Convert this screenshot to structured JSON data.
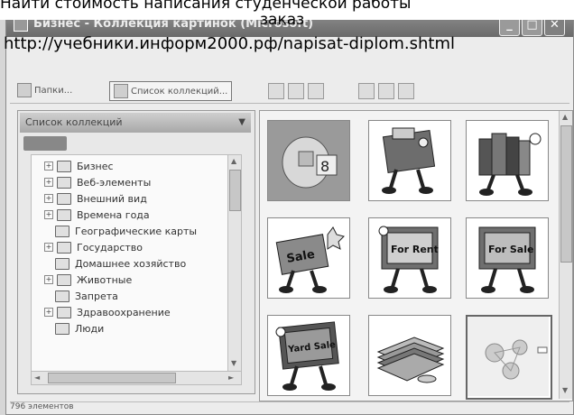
{
  "overlay": {
    "line1": "Найти стоимость написания студенческой работы",
    "line2": "заказ",
    "url": "http://учебники.информ2000.рф/napisat-diplom.shtml"
  },
  "window": {
    "title": "Бизнес - Коллекция картинок (Microsoft)",
    "min_label": "_",
    "max_label": "□",
    "close_label": "✕"
  },
  "toolbar": {
    "items": [
      {
        "label": "Папки..."
      },
      {
        "label": "Список коллекций..."
      }
    ]
  },
  "left_pane": {
    "header": "Список коллекций",
    "tree": [
      {
        "label": "Бизнес",
        "expandable": true
      },
      {
        "label": "Веб-элементы",
        "expandable": true
      },
      {
        "label": "Внешний вид",
        "expandable": true
      },
      {
        "label": "Времена года",
        "expandable": true
      },
      {
        "label": "Географические карты",
        "expandable": false
      },
      {
        "label": "Государство",
        "expandable": true
      },
      {
        "label": "Домашнее хозяйство",
        "expandable": false
      },
      {
        "label": "Животные",
        "expandable": true
      },
      {
        "label": "Запрета",
        "expandable": false
      },
      {
        "label": "Здравоохранение",
        "expandable": true
      },
      {
        "label": "Люди",
        "expandable": false
      }
    ]
  },
  "clips": [
    {
      "name": "clip-robot",
      "text": "8"
    },
    {
      "name": "clip-wallet-walker",
      "text": ""
    },
    {
      "name": "clip-books-walker",
      "text": ""
    },
    {
      "name": "clip-sale-sign",
      "text": "Sale"
    },
    {
      "name": "clip-for-rent",
      "text": "For Rent"
    },
    {
      "name": "clip-for-sale",
      "text": "For Sale"
    },
    {
      "name": "clip-yard-sale",
      "text": "Yard Sale"
    },
    {
      "name": "clip-money-stack",
      "text": ""
    },
    {
      "name": "clip-network",
      "text": ""
    }
  ],
  "status": {
    "text": "796 элементов"
  }
}
